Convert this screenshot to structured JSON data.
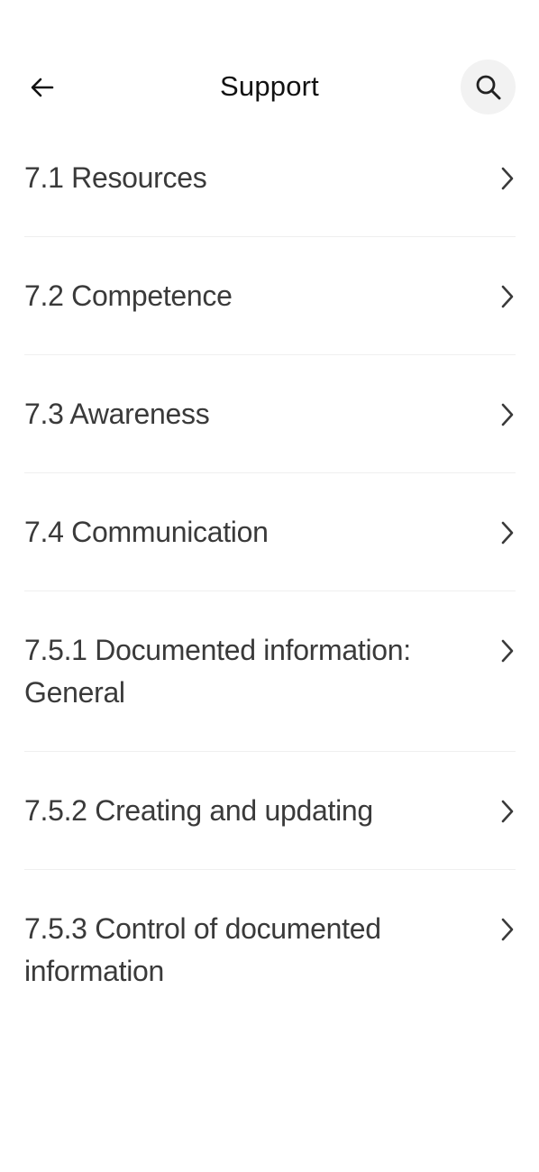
{
  "header": {
    "title": "Support",
    "back_icon": "arrow-left-icon",
    "search_icon": "search-icon"
  },
  "items": [
    {
      "label": "7.1 Resources"
    },
    {
      "label": "7.2 Competence"
    },
    {
      "label": "7.3 Awareness"
    },
    {
      "label": "7.4 Communication"
    },
    {
      "label": "7.5.1 Documented information: General"
    },
    {
      "label": "7.5.2 Creating and updating"
    },
    {
      "label": "7.5.3 Control of documented information"
    }
  ],
  "colors": {
    "text": "#3a3a3a",
    "title": "#111111",
    "search_bg": "#f2f2f2",
    "divider": "#efefef"
  }
}
